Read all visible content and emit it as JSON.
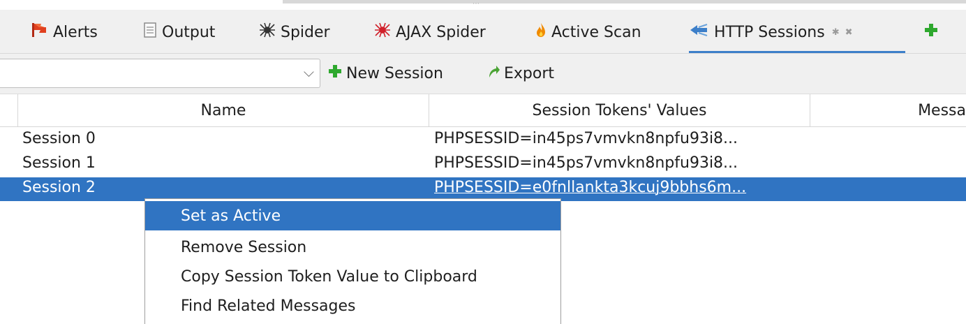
{
  "tabs": [
    {
      "label": "Alerts",
      "icon": "flag-icon",
      "color": "#d23a1e"
    },
    {
      "label": "Output",
      "icon": "document-icon",
      "color": "#8a8a8a"
    },
    {
      "label": "Spider",
      "icon": "spider-icon",
      "color": "#333333"
    },
    {
      "label": "AJAX Spider",
      "icon": "red-spider-icon",
      "color": "#d0202a"
    },
    {
      "label": "Active Scan",
      "icon": "flame-icon",
      "color": "#f08a00"
    },
    {
      "label": "HTTP Sessions",
      "icon": "http-sessions-icon",
      "color": "#3d7fc9",
      "active": true
    }
  ],
  "tabbar": {
    "add_icon": "plus-icon",
    "pin_icon": "pin-icon",
    "close_icon": "close-icon"
  },
  "toolbar": {
    "site_select_value": "",
    "new_session_label": "New Session",
    "export_label": "Export"
  },
  "table": {
    "headers": {
      "name": "Name",
      "tokens": "Session Tokens' Values",
      "messages": "Messa"
    },
    "rows": [
      {
        "name": "Session 0",
        "tokens": "PHPSESSID=in45ps7vmvkn8npfu93i8..."
      },
      {
        "name": "Session 1",
        "tokens": "PHPSESSID=in45ps7vmvkn8npfu93i8..."
      },
      {
        "name": "Session 2",
        "tokens": "PHPSESSID=e0fnllankta3kcuj9bbhs6m...",
        "selected": true
      }
    ]
  },
  "context_menu": {
    "items": [
      {
        "label": "Set as Active",
        "highlighted": true
      },
      {
        "label": "Remove Session"
      },
      {
        "label": "Copy Session Token Value to Clipboard"
      },
      {
        "label": "Find Related Messages"
      }
    ]
  },
  "colors": {
    "accent": "#3074c2",
    "add_green": "#2ea82e"
  }
}
